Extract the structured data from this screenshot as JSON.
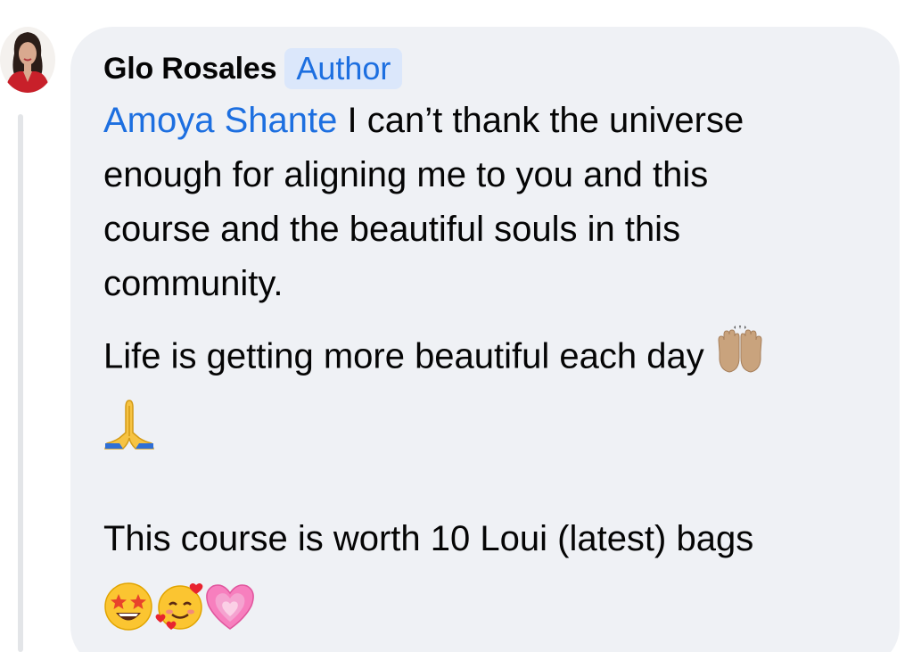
{
  "comment": {
    "author_name": "Glo Rosales",
    "author_badge": "Author",
    "mention": "Amoya Shante",
    "paragraph1": {
      "line1": "I can’t thank the universe",
      "line2": "enough for aligning me to you and this",
      "line3": "course and the beautiful souls in this",
      "line4": "community."
    },
    "paragraph2": "Life is getting more beautiful each day",
    "paragraph3": "This course is worth 10 Loui (latest) bags",
    "emojis": {
      "raised_hands": "raised-hands-icon",
      "folded_hands": "folded-hands-icon",
      "star_struck": "star-struck-icon",
      "smiling_hearts": "smiling-face-with-hearts-icon",
      "growing_heart": "growing-heart-icon"
    },
    "colors": {
      "mention": "#1d6fe0",
      "badge_bg": "#dbe7fb",
      "bubble_bg": "#eff1f5"
    }
  }
}
